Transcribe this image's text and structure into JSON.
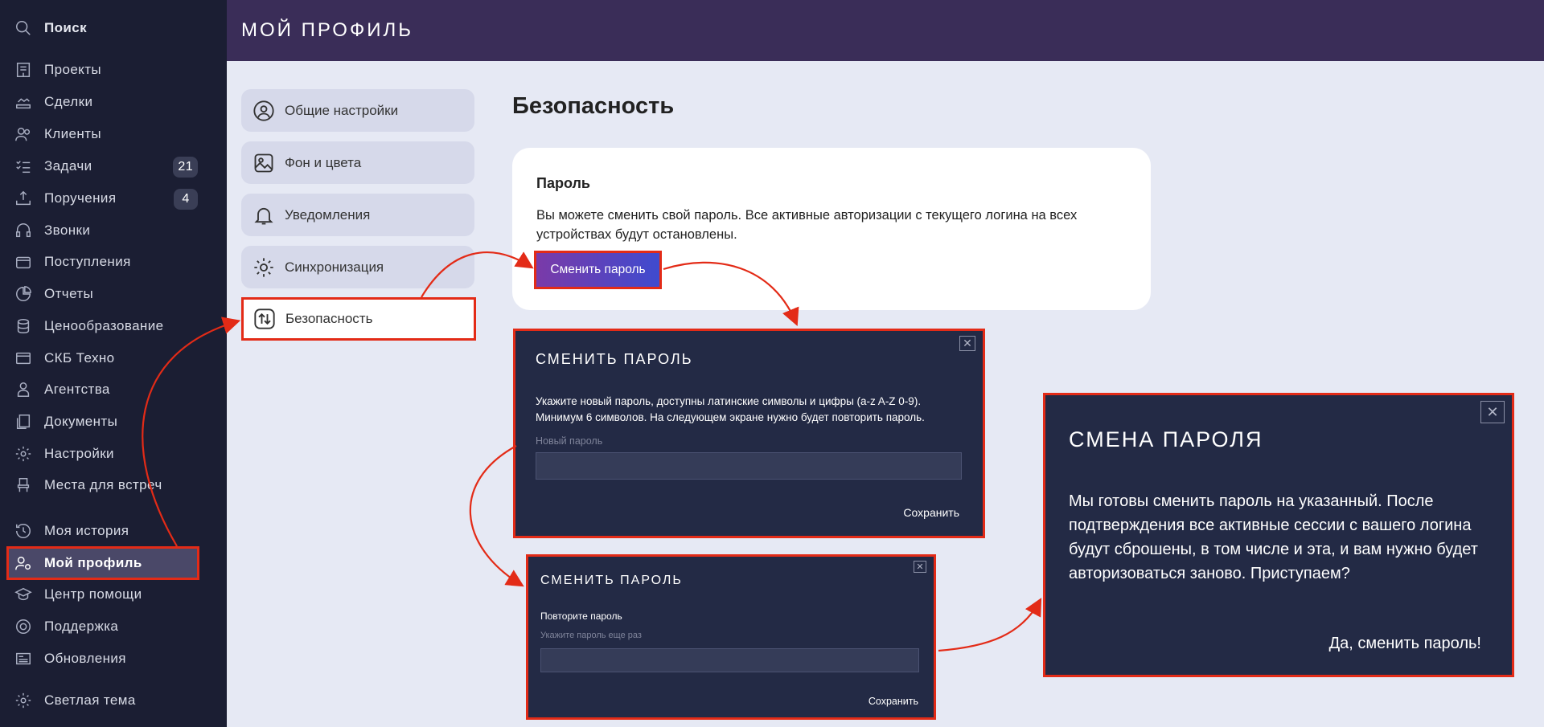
{
  "sidebar": {
    "search": "Поиск",
    "items": [
      {
        "label": "Проекты"
      },
      {
        "label": "Сделки"
      },
      {
        "label": "Клиенты"
      },
      {
        "label": "Задачи",
        "badge": "21"
      },
      {
        "label": "Поручения",
        "badge": "4"
      },
      {
        "label": "Звонки"
      },
      {
        "label": "Поступления"
      },
      {
        "label": "Отчеты"
      },
      {
        "label": "Ценообразование"
      },
      {
        "label": "СКБ Техно"
      },
      {
        "label": "Агентства"
      },
      {
        "label": "Документы"
      },
      {
        "label": "Настройки"
      },
      {
        "label": "Места для встреч"
      }
    ],
    "bottom": [
      {
        "label": "Моя история"
      },
      {
        "label": "Мой профиль"
      },
      {
        "label": "Центр помощи"
      },
      {
        "label": "Поддержка"
      },
      {
        "label": "Обновления"
      }
    ],
    "theme": "Светлая тема"
  },
  "header": {
    "title": "МОЙ ПРОФИЛЬ"
  },
  "settings_menu": [
    {
      "label": "Общие настройки"
    },
    {
      "label": "Фон и цвета"
    },
    {
      "label": "Уведомления"
    },
    {
      "label": "Синхронизация"
    },
    {
      "label": "Безопасность"
    }
  ],
  "content": {
    "title": "Безопасность",
    "card": {
      "heading": "Пароль",
      "text": "Вы можете сменить свой пароль. Все активные авторизации с текущего логина на всех устройствах будут остановлены.",
      "button": "Сменить пароль"
    }
  },
  "modal_new": {
    "title": "СМЕНИТЬ ПАРОЛЬ",
    "text": "Укажите новый пароль, доступны латинские символы и цифры (a-z A-Z 0-9). Минимум 6 символов. На следующем экране нужно будет повторить пароль.",
    "field_label": "Новый пароль",
    "save": "Сохранить"
  },
  "modal_repeat": {
    "title": "СМЕНИТЬ ПАРОЛЬ",
    "text": "Повторите пароль",
    "field_label": "Укажите пароль еще раз",
    "save": "Сохранить"
  },
  "modal_confirm": {
    "title": "СМЕНА ПАРОЛЯ",
    "text": "Мы готовы сменить пароль на указанный. После подтверждения все активные сессии с вашего логина будут сброшены, в том числе и эта, и вам нужно будет авторизоваться заново. Приступаем?",
    "confirm": "Да, сменить пароль!"
  },
  "colors": {
    "highlight": "#e32b17",
    "sidebar_bg": "#1b1e33",
    "header_bg": "#3a2d58",
    "modal_bg": "#232a45"
  }
}
